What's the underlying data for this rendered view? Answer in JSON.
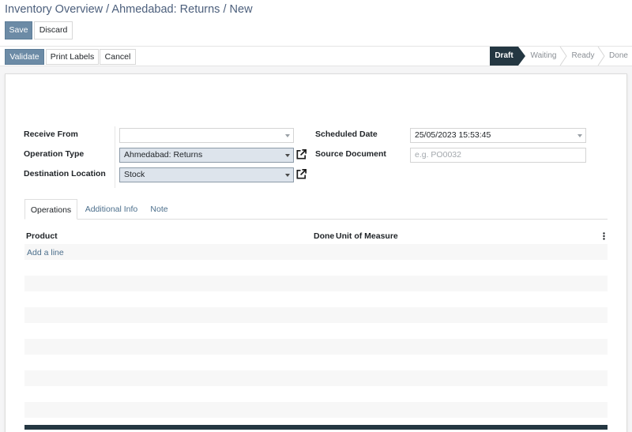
{
  "breadcrumb": {
    "part1": "Inventory Overview",
    "sep1": " / ",
    "part2": "Ahmedabad: Returns",
    "sep2": " / ",
    "part3": "New"
  },
  "toolbar": {
    "save_label": "Save",
    "discard_label": "Discard"
  },
  "actions": {
    "validate_label": "Validate",
    "print_labels_label": "Print Labels",
    "cancel_label": "Cancel"
  },
  "stages": [
    {
      "label": "Draft",
      "active": true
    },
    {
      "label": "Waiting",
      "active": false
    },
    {
      "label": "Ready",
      "active": false
    },
    {
      "label": "Done",
      "active": false
    }
  ],
  "form": {
    "receive_from_label": "Receive From",
    "receive_from_value": "",
    "operation_type_label": "Operation Type",
    "operation_type_value": "Ahmedabad: Returns",
    "destination_label": "Destination Location",
    "destination_value": "Stock",
    "scheduled_date_label": "Scheduled Date",
    "scheduled_date_value": "25/05/2023 15:53:45",
    "source_document_label": "Source Document",
    "source_document_placeholder": "e.g. PO0032"
  },
  "tabs": [
    {
      "label": "Operations",
      "active": true
    },
    {
      "label": "Additional Info",
      "active": false
    },
    {
      "label": "Note",
      "active": false
    }
  ],
  "table": {
    "headers": {
      "product": "Product",
      "done": "Done",
      "uom": "Unit of Measure"
    },
    "add_line_label": "Add a line"
  },
  "colors": {
    "primary": "#6c8ba6",
    "active_stage": "#243742",
    "link": "#4c6f8c"
  },
  "icons": {
    "external_link": "external-link-icon",
    "dropdown": "caret-down-icon",
    "menu": "vertical-dots-icon"
  }
}
